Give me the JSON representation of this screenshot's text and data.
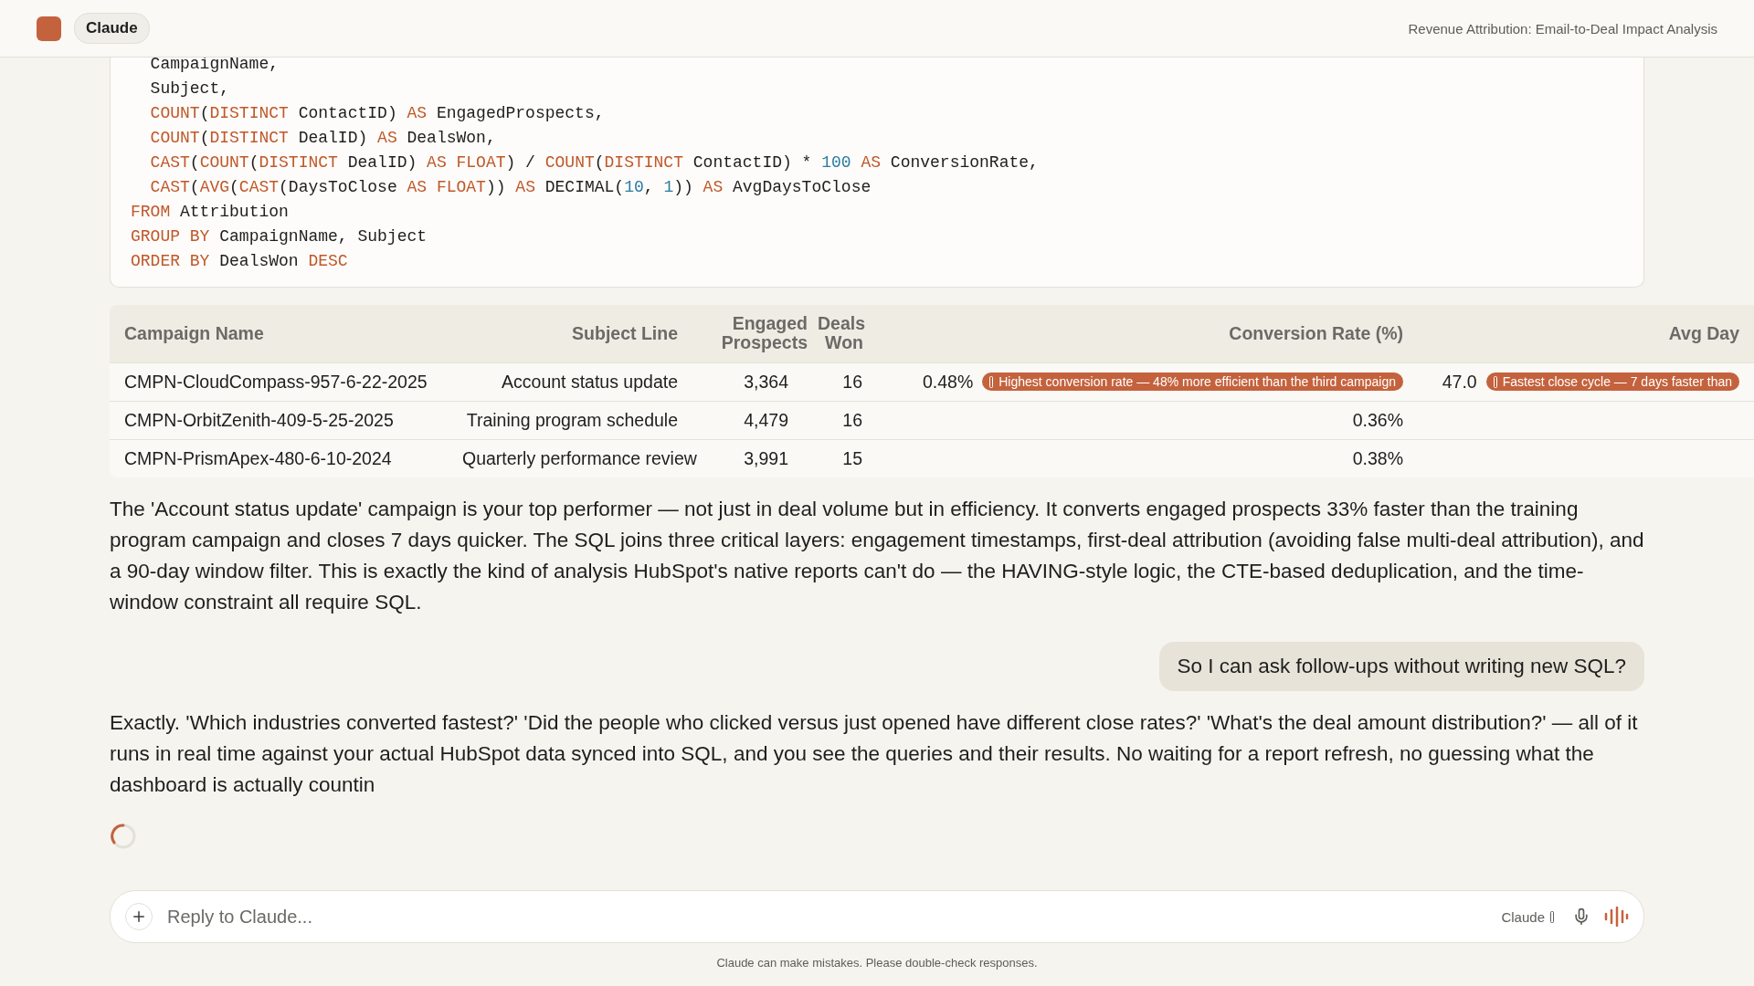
{
  "header": {
    "app_name": "Claude",
    "title": "Revenue Attribution: Email-to-Deal Impact Analysis"
  },
  "code": {
    "lines": [
      [
        {
          "kind": "text",
          "text": "  CampaignName,"
        }
      ],
      [
        {
          "kind": "text",
          "text": "  Subject,"
        }
      ],
      [
        {
          "kind": "kw",
          "text": "  COUNT"
        },
        {
          "kind": "text",
          "text": "("
        },
        {
          "kind": "kw",
          "text": "DISTINCT"
        },
        {
          "kind": "text",
          "text": " ContactID) "
        },
        {
          "kind": "kw",
          "text": "AS"
        },
        {
          "kind": "text",
          "text": " EngagedProspects,"
        }
      ],
      [
        {
          "kind": "kw",
          "text": "  COUNT"
        },
        {
          "kind": "text",
          "text": "("
        },
        {
          "kind": "kw",
          "text": "DISTINCT"
        },
        {
          "kind": "text",
          "text": " DealID) "
        },
        {
          "kind": "kw",
          "text": "AS"
        },
        {
          "kind": "text",
          "text": " DealsWon,"
        }
      ],
      [
        {
          "kind": "kw",
          "text": "  CAST"
        },
        {
          "kind": "text",
          "text": "("
        },
        {
          "kind": "kw",
          "text": "COUNT"
        },
        {
          "kind": "text",
          "text": "("
        },
        {
          "kind": "kw",
          "text": "DISTINCT"
        },
        {
          "kind": "text",
          "text": " DealID) "
        },
        {
          "kind": "kw",
          "text": "AS FLOAT"
        },
        {
          "kind": "text",
          "text": ") / "
        },
        {
          "kind": "kw",
          "text": "COUNT"
        },
        {
          "kind": "text",
          "text": "("
        },
        {
          "kind": "kw",
          "text": "DISTINCT"
        },
        {
          "kind": "text",
          "text": " ContactID) * "
        },
        {
          "kind": "num",
          "text": "100"
        },
        {
          "kind": "kw",
          "text": " AS"
        },
        {
          "kind": "text",
          "text": " ConversionRate,"
        }
      ],
      [
        {
          "kind": "kw",
          "text": "  CAST"
        },
        {
          "kind": "text",
          "text": "("
        },
        {
          "kind": "kw",
          "text": "AVG"
        },
        {
          "kind": "text",
          "text": "("
        },
        {
          "kind": "kw",
          "text": "CAST"
        },
        {
          "kind": "text",
          "text": "(DaysToClose "
        },
        {
          "kind": "kw",
          "text": "AS FLOAT"
        },
        {
          "kind": "text",
          "text": ")) "
        },
        {
          "kind": "kw",
          "text": "AS"
        },
        {
          "kind": "text",
          "text": " DECIMAL("
        },
        {
          "kind": "num",
          "text": "10"
        },
        {
          "kind": "text",
          "text": ", "
        },
        {
          "kind": "num",
          "text": "1"
        },
        {
          "kind": "text",
          "text": ")) "
        },
        {
          "kind": "kw",
          "text": "AS"
        },
        {
          "kind": "text",
          "text": " AvgDaysToClose"
        }
      ],
      [
        {
          "kind": "kw",
          "text": "FROM"
        },
        {
          "kind": "text",
          "text": " Attribution"
        }
      ],
      [
        {
          "kind": "kw",
          "text": "GROUP BY"
        },
        {
          "kind": "text",
          "text": " CampaignName, Subject"
        }
      ],
      [
        {
          "kind": "kw",
          "text": "ORDER BY"
        },
        {
          "kind": "text",
          "text": " DealsWon "
        },
        {
          "kind": "kw",
          "text": "DESC"
        }
      ]
    ]
  },
  "table": {
    "columns": [
      {
        "label": "Campaign Name"
      },
      {
        "label": "Subject Line"
      },
      {
        "label": "Engaged Prospects"
      },
      {
        "label": "Deals Won"
      },
      {
        "label": "Conversion Rate (%)"
      },
      {
        "label": "Avg Day"
      }
    ],
    "rows": [
      {
        "campaign": "CMPN-CloudCompass-957-6-22-2025",
        "subject": "Account status update",
        "engaged": "3,364",
        "deals": "16",
        "conversion": "0.48%",
        "conversion_note": "Highest conversion rate — 48% more efficient than the third campaign",
        "avg_days": "47.0",
        "avg_note": "Fastest close cycle — 7 days faster than"
      },
      {
        "campaign": "CMPN-OrbitZenith-409-5-25-2025",
        "subject": "Training program schedule",
        "engaged": "4,479",
        "deals": "16",
        "conversion": "0.36%"
      },
      {
        "campaign": "CMPN-PrismApex-480-6-10-2024",
        "subject": "Quarterly performance review",
        "engaged": "3,991",
        "deals": "15",
        "conversion": "0.38%"
      }
    ]
  },
  "messages": [
    {
      "kind": "assistant",
      "text": "The 'Account status update' campaign is your top performer — not just in deal volume but in efficiency. It converts engaged prospects 33% faster than the training program campaign and closes 7 days quicker. The SQL joins three critical layers: engagement timestamps, first-deal attribution (avoiding false multi-deal attribution), and a 90-day window filter. This is exactly the kind of analysis HubSpot's native reports can't do — the HAVING-style logic, the CTE-based deduplication, and the time-window constraint all require SQL."
    },
    {
      "kind": "user",
      "text": "So I can ask follow-ups without writing new SQL?"
    },
    {
      "kind": "assistant",
      "text": "Exactly. 'Which industries converted fastest?' 'Did the people who clicked versus just opened have different close rates?' 'What's the deal amount distribution?' — all of it runs in real time against your actual HubSpot data synced into SQL, and you see the queries and their results. No waiting for a report refresh, no guessing what the dashboard is actually countin"
    }
  ],
  "streaming": true,
  "composer": {
    "placeholder": "Reply to Claude...",
    "model": "Claude"
  },
  "disclaimer": "Claude can make mistakes. Please double-check responses."
}
